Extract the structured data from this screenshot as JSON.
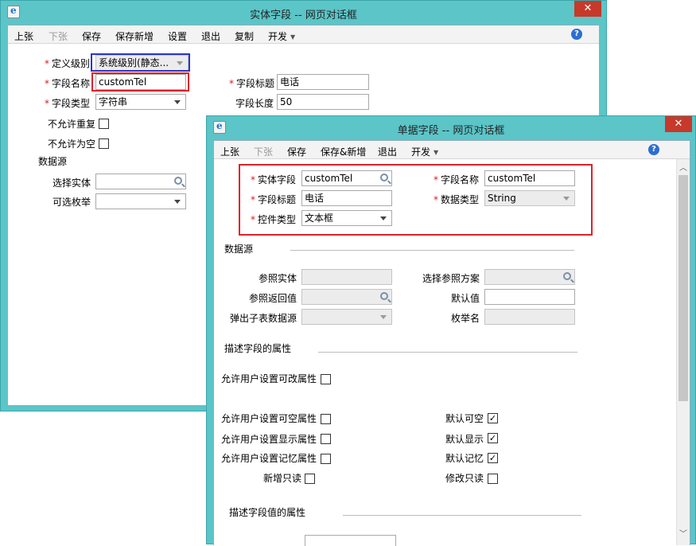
{
  "win1": {
    "title": "实体字段 -- 网页对话框",
    "close": "✕",
    "toolbar": [
      "上张",
      "下张",
      "保存",
      "保存新增",
      "设置",
      "退出",
      "复制",
      "开发"
    ],
    "help": "?",
    "fields": {
      "def_level_label": "定义级别",
      "def_level_value": "系统级别(静态...",
      "name_label": "字段名称",
      "name_value": "customTel",
      "title_label": "字段标题",
      "title_value": "电话",
      "type_label": "字段类型",
      "type_value": "字符串",
      "length_label": "字段长度",
      "length_value": "50",
      "no_dup_label": "不允许重复",
      "no_null_label": "不允许为空",
      "datasource_label": "数据源",
      "select_entity_label": "选择实体",
      "enum_label": "可选枚举"
    }
  },
  "win2": {
    "title": "单据字段 -- 网页对话框",
    "close": "✕",
    "toolbar": [
      "上张",
      "下张",
      "保存",
      "保存&新增",
      "退出",
      "开发"
    ],
    "help": "?",
    "fields": {
      "entity_field_label": "实体字段",
      "entity_field_value": "customTel",
      "field_name_label": "字段名称",
      "field_name_value": "customTel",
      "field_title_label": "字段标题",
      "field_title_value": "电话",
      "data_type_label": "数据类型",
      "data_type_value": "String",
      "control_type_label": "控件类型",
      "control_type_value": "文本框",
      "datasource_label": "数据源",
      "ref_entity_label": "参照实体",
      "ref_scheme_label": "选择参照方案",
      "ref_return_label": "参照返回值",
      "default_value_label": "默认值",
      "popup_child_label": "弹出子表数据源",
      "enum_name_label": "枚举名",
      "desc_field_attr": "描述字段的属性",
      "allow_editable": "允许用户设置可改属性",
      "allow_nullable": "允许用户设置可空属性",
      "allow_visible": "允许用户设置显示属性",
      "allow_memory": "允许用户设置记忆属性",
      "new_readonly": "新增只读",
      "default_nullable": "默认可空",
      "default_visible": "默认显示",
      "default_memory": "默认记忆",
      "edit_readonly": "修改只读",
      "desc_value_attr": "描述字段值的属性",
      "check": "✓"
    }
  }
}
